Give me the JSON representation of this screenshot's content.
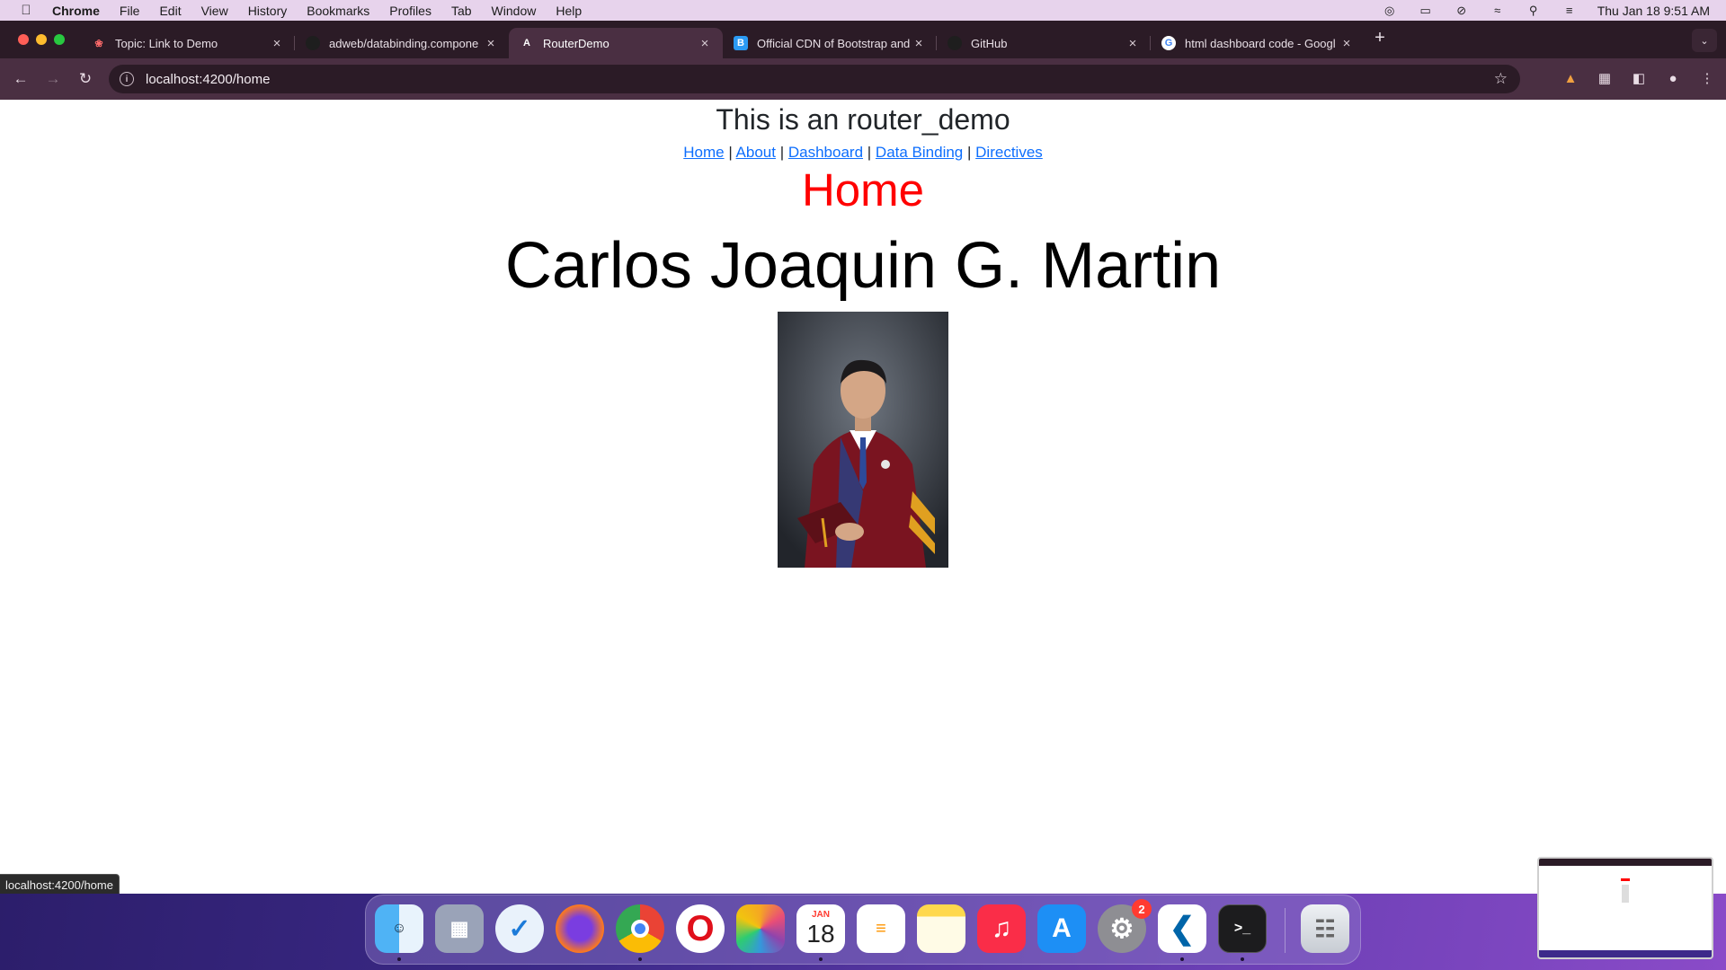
{
  "menubar": {
    "app": "Chrome",
    "items": [
      "File",
      "Edit",
      "View",
      "History",
      "Bookmarks",
      "Profiles",
      "Tab",
      "Window",
      "Help"
    ],
    "datetime": "Thu Jan 18  9:51 AM"
  },
  "tabs": [
    {
      "title": "Topic: Link to Demo",
      "favicon": "pinwheel-icon",
      "active": false
    },
    {
      "title": "adweb/databinding.compone",
      "favicon": "github-icon",
      "active": false
    },
    {
      "title": "RouterDemo",
      "favicon": "angular-icon",
      "active": true
    },
    {
      "title": "Official CDN of Bootstrap and",
      "favicon": "bootstrap-icon",
      "active": false
    },
    {
      "title": "GitHub",
      "favicon": "github-icon",
      "active": false
    },
    {
      "title": "html dashboard code - Googl",
      "favicon": "google-icon",
      "active": false
    }
  ],
  "toolbar": {
    "url": "localhost:4200/home"
  },
  "page": {
    "site_title": "This is an router_demo",
    "nav": {
      "home": "Home",
      "about": "About",
      "dashboard": "Dashboard",
      "data_binding": "Data Binding",
      "directives": "Directives",
      "separator": "|"
    },
    "heading": "Home",
    "name": "Carlos Joaquin G. Martin"
  },
  "statusbar": {
    "link": "localhost:4200/home"
  },
  "dock": {
    "calendar_month": "JAN",
    "calendar_day": "18",
    "settings_badge": "2"
  },
  "colors": {
    "heading": "#ff0000",
    "link": "#0d6efd",
    "tab_active": "#4a2f42",
    "tab_strip": "#2b1b26"
  }
}
